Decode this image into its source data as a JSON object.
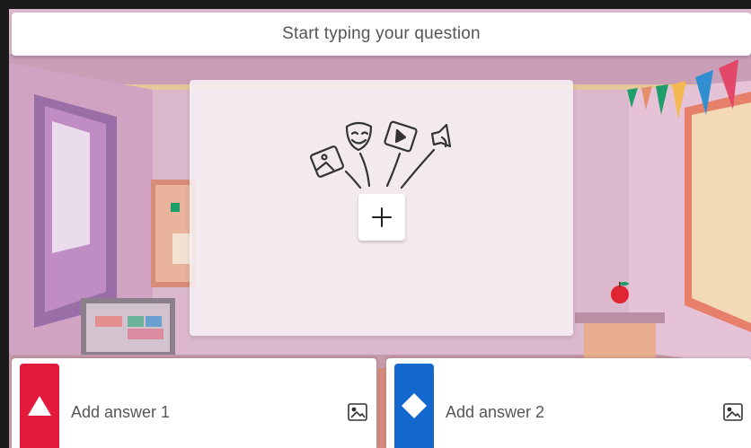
{
  "question": {
    "placeholder": "Start typing your question"
  },
  "media": {
    "add_icon": "plus-icon",
    "art_icons": [
      "image-icon",
      "mask-icon",
      "video-icon",
      "sound-icon"
    ]
  },
  "answers": [
    {
      "label": "Add answer 1",
      "shape": "triangle",
      "color": "#e21b3c",
      "image_icon": "image-icon"
    },
    {
      "label": "Add answer 2",
      "shape": "diamond",
      "color": "#1368ce",
      "image_icon": "image-icon"
    }
  ],
  "colors": {
    "answer_red": "#e21b3c",
    "answer_blue": "#1368ce"
  }
}
